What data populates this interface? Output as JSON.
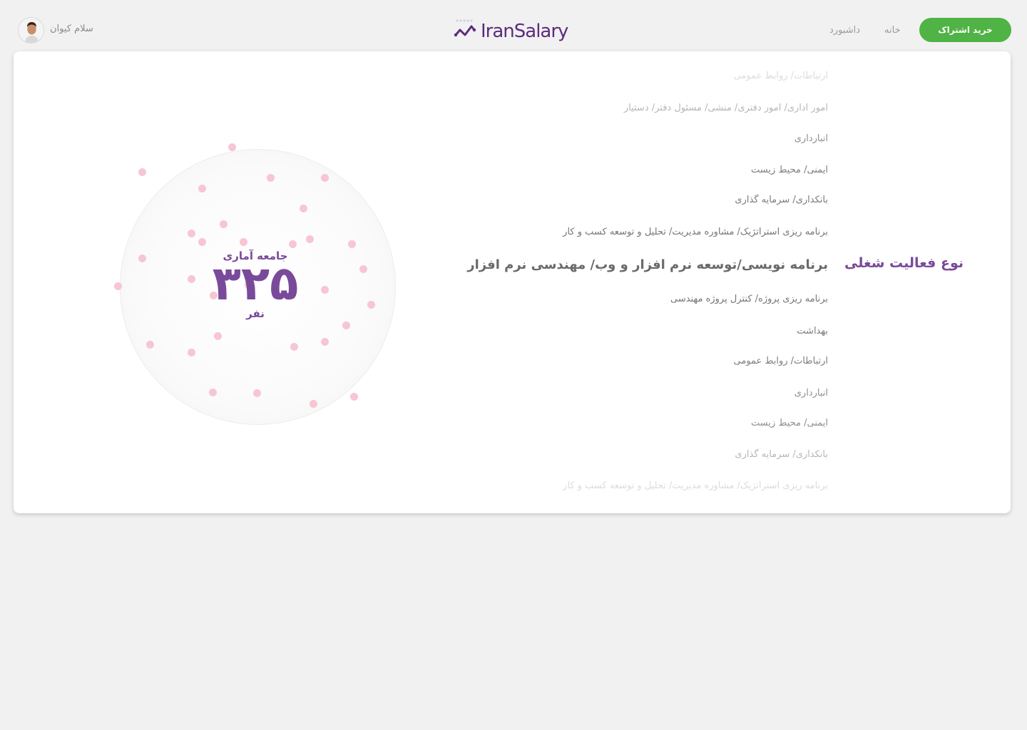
{
  "header": {
    "greeting": "سلام کیوان",
    "logo_text": "IranSalary",
    "nav": {
      "home": "خانه",
      "dashboard": "داشبورد"
    },
    "buy_subscription": "خرید اشتراک"
  },
  "filter": {
    "title": "نوع فعالیت شغلی",
    "items": [
      {
        "label": "ارتباطات/ روابط عمومی"
      },
      {
        "label": "امور اداری/ امور دفتری/ منشی/ مسئول دفتر/ دستیار"
      },
      {
        "label": "انبارداری"
      },
      {
        "label": "ایمنی/ محیط زیست"
      },
      {
        "label": "بانکداری/ سرمایه گذاری"
      },
      {
        "label": "برنامه ریزی استراتژیک/ مشاوره مدیریت/ تحلیل و توسعه کسب و کار"
      },
      {
        "label": "برنامه نویسی/توسعه نرم افزار و وب/ مهندسی نرم افزار"
      },
      {
        "label": "برنامه ریزی پروژه/ کنترل پروژه مهندسی"
      },
      {
        "label": "بهداشت"
      },
      {
        "label": "ارتباطات/ روابط عمومی"
      },
      {
        "label": "انبارداری"
      },
      {
        "label": "ایمنی/ محیط زیست"
      },
      {
        "label": "بانکداری/ سرمایه گذاری"
      },
      {
        "label": "برنامه ریزی استراتژیک/ مشاوره مدیریت/ تحلیل و توسعه کسب و کار"
      }
    ],
    "selected_index": 6
  },
  "stats": {
    "label": "جامعه آماری",
    "value": "۳۲۵",
    "unit": "نفر"
  },
  "colors": {
    "brand_purple": "#7a4a9a",
    "logo_purple": "#5b2d7e",
    "accent_green": "#4fb345",
    "dot_pink": "#f7c6d2"
  }
}
